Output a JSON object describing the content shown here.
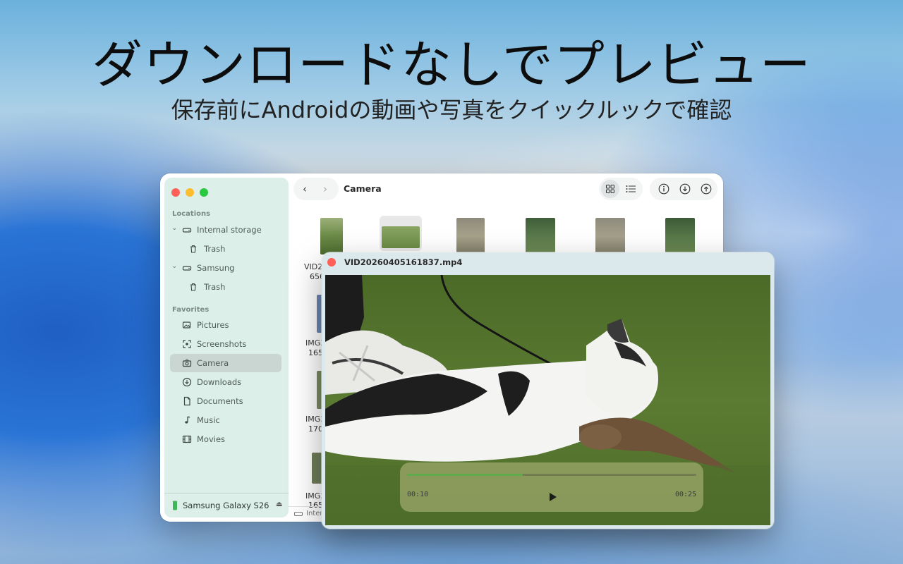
{
  "promo": {
    "headline": "ダウンロードなしでプレビュー",
    "subline": "保存前にAndroidの動画や写真をクイックルックで確認"
  },
  "finder": {
    "toolbar": {
      "path_title": "Camera"
    },
    "sidebar": {
      "locations_label": "Locations",
      "favorites_label": "Favorites",
      "locations": [
        {
          "label": "Internal storage",
          "icon": "drive-icon"
        },
        {
          "label": "Trash",
          "icon": "trash-icon"
        },
        {
          "label": "Samsung",
          "icon": "drive-icon"
        },
        {
          "label": "Trash",
          "icon": "trash-icon"
        }
      ],
      "favorites": [
        {
          "label": "Pictures",
          "icon": "pictures-icon"
        },
        {
          "label": "Screenshots",
          "icon": "screenshot-icon"
        },
        {
          "label": "Camera",
          "icon": "camera-icon",
          "selected": true
        },
        {
          "label": "Downloads",
          "icon": "download-icon"
        },
        {
          "label": "Documents",
          "icon": "document-icon"
        },
        {
          "label": "Music",
          "icon": "music-icon"
        },
        {
          "label": "Movies",
          "icon": "film-icon"
        }
      ],
      "device": {
        "label": "Samsung Galaxy S26",
        "icon": "phone-icon"
      }
    },
    "file_labels": [
      {
        "line1": "VID2",
        "line2": "656"
      },
      {
        "line1": "IMG2",
        "line2": "165"
      },
      {
        "line1": "IMG2",
        "line2": "170"
      },
      {
        "line1": "IMG2",
        "line2": "165"
      }
    ],
    "status_bar": {
      "text": "Inter"
    }
  },
  "preview": {
    "title": "VID20260405161837.mp4",
    "elapsed": "00:10",
    "duration": "00:25",
    "progress_fraction": 0.4
  },
  "colors": {
    "accent_progress": "#5faa4a",
    "close_red": "#ff5f57"
  }
}
